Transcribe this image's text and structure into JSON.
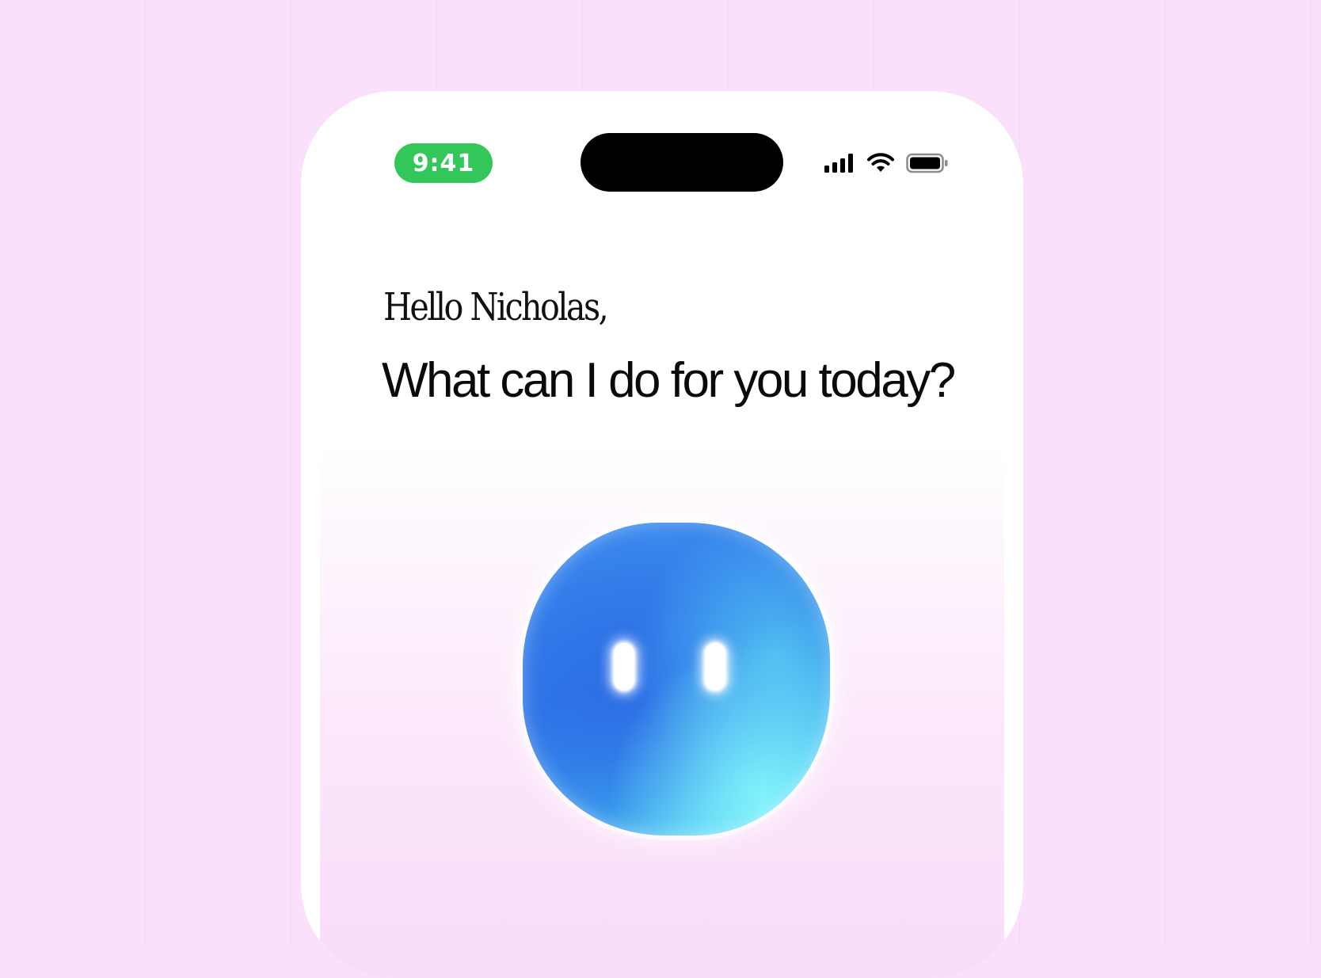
{
  "status_bar": {
    "time": "9:41",
    "time_pill_color": "#33c759",
    "icons": [
      "cellular-signal-icon",
      "wifi-icon",
      "battery-icon"
    ]
  },
  "greeting": {
    "line1": "Hello Nicholas,",
    "line2": "What can I do for you today?"
  },
  "assistant": {
    "icon": "assistant-orb-icon",
    "colors": {
      "primary": "#2f78e8",
      "secondary": "#6de6f8"
    }
  },
  "colors": {
    "background": "#fbe0fb",
    "phone_frame": "#ffffff",
    "dynamic_island": "#000000"
  }
}
